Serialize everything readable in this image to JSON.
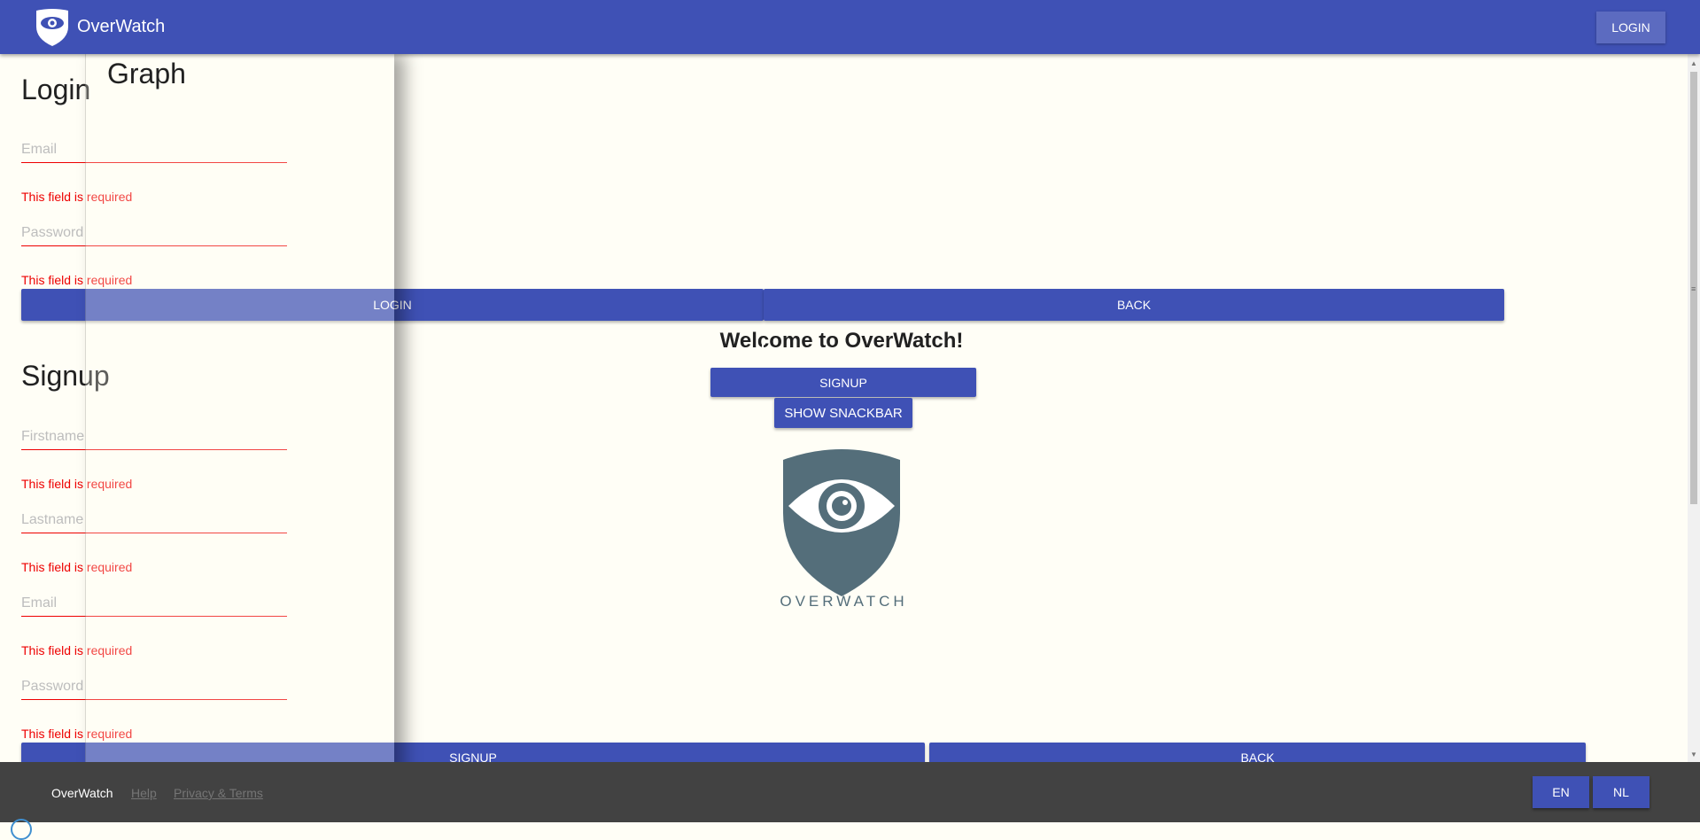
{
  "header": {
    "brand": "OverWatch",
    "login_label": "LOGIN"
  },
  "center": {
    "welcome": "Welcome to OverWatch!",
    "signup_label": "SIGNUP",
    "snackbar_label": "SHOW SNACKBAR",
    "logo_text": "OVERWATCH"
  },
  "login": {
    "heading": "Login",
    "email_placeholder": "Email",
    "password_placeholder": "Password",
    "required_msg": "This field is required",
    "login_button": "LOGIN",
    "back_button": "BACK"
  },
  "signup": {
    "heading": "Signup",
    "firstname_placeholder": "Firstname",
    "lastname_placeholder": "Lastname",
    "email_placeholder": "Email",
    "password_placeholder": "Password",
    "required_msg": "This field is required",
    "signup_button": "SIGNUP",
    "back_button": "BACK"
  },
  "drawer": {
    "title": "Graph"
  },
  "footer": {
    "brand": "OverWatch",
    "help": "Help",
    "privacy": "Privacy & Terms",
    "lang_en": "EN",
    "lang_nl": "NL"
  },
  "colors": {
    "primary": "#3f51b5",
    "error": "#ee0000",
    "footer": "#424242",
    "logo": "#546e7a"
  },
  "icons": {
    "brand": "shield-eye-icon",
    "big_logo": "shield-eye-logo"
  }
}
